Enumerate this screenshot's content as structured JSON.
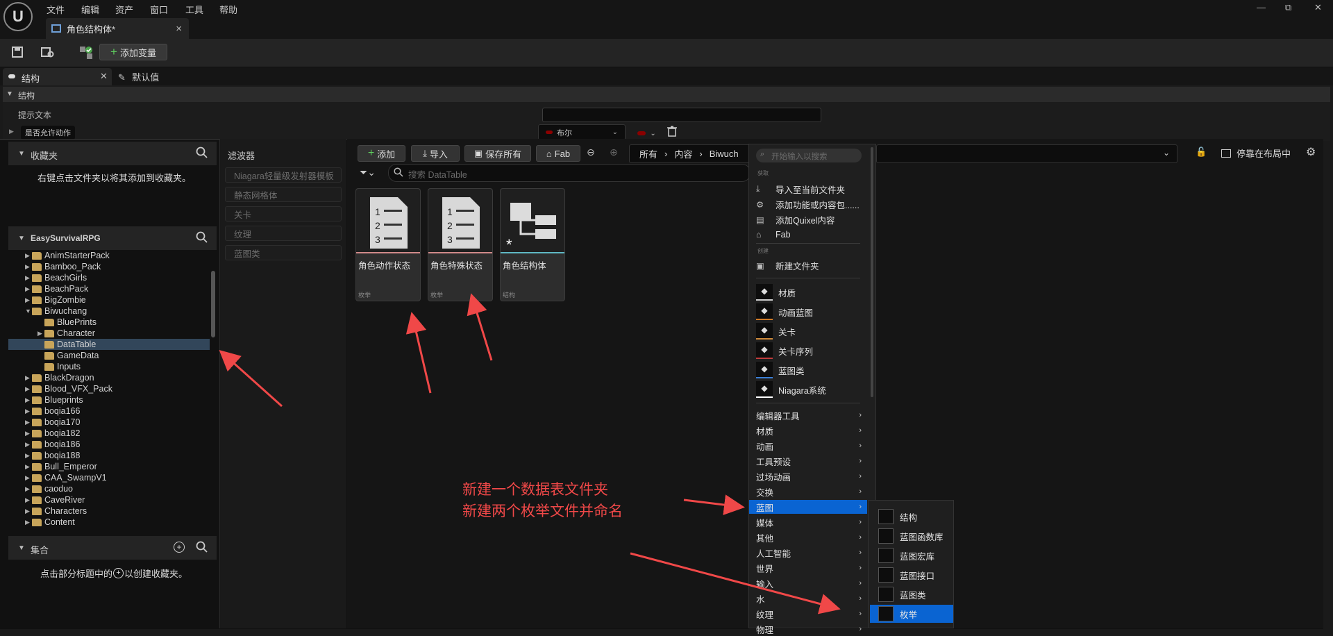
{
  "menubar": {
    "items": [
      "文件",
      "编辑",
      "资产",
      "窗口",
      "工具",
      "帮助"
    ],
    "window_controls": [
      "—",
      "⧉",
      "✕"
    ]
  },
  "tab": {
    "title": "角色结构体*",
    "close": "×"
  },
  "toolbar": {
    "add_variable": "添加变量",
    "add_icon": "+"
  },
  "structure_panel": {
    "tabs": [
      "结构",
      "默认值"
    ],
    "header": "结构",
    "rows": [
      {
        "label": "提示文本",
        "value": ""
      },
      {
        "label": "是否允许动作",
        "type": "布尔"
      }
    ]
  },
  "favorites": {
    "title": "收藏夹",
    "hint": "右键点击文件夹以将其添加到收藏夹。"
  },
  "project": {
    "title": "EasySurvivalRPG"
  },
  "tree": [
    {
      "label": "AnimStarterPack",
      "depth": 0,
      "expand": "▶"
    },
    {
      "label": "Bamboo_Pack",
      "depth": 0,
      "expand": "▶"
    },
    {
      "label": "BeachGirls",
      "depth": 0,
      "expand": "▶"
    },
    {
      "label": "BeachPack",
      "depth": 0,
      "expand": "▶"
    },
    {
      "label": "BigZombie",
      "depth": 0,
      "expand": "▶"
    },
    {
      "label": "Biwuchang",
      "depth": 0,
      "expand": "▼"
    },
    {
      "label": "BluePrints",
      "depth": 1,
      "expand": ""
    },
    {
      "label": "Character",
      "depth": 1,
      "expand": "▶"
    },
    {
      "label": "DataTable",
      "depth": 1,
      "expand": "",
      "selected": true
    },
    {
      "label": "GameData",
      "depth": 1,
      "expand": ""
    },
    {
      "label": "Inputs",
      "depth": 1,
      "expand": ""
    },
    {
      "label": "BlackDragon",
      "depth": 0,
      "expand": "▶"
    },
    {
      "label": "Blood_VFX_Pack",
      "depth": 0,
      "expand": "▶"
    },
    {
      "label": "Blueprints",
      "depth": 0,
      "expand": "▶"
    },
    {
      "label": "boqia166",
      "depth": 0,
      "expand": "▶"
    },
    {
      "label": "boqia170",
      "depth": 0,
      "expand": "▶"
    },
    {
      "label": "boqia182",
      "depth": 0,
      "expand": "▶"
    },
    {
      "label": "boqia186",
      "depth": 0,
      "expand": "▶"
    },
    {
      "label": "boqia188",
      "depth": 0,
      "expand": "▶"
    },
    {
      "label": "Bull_Emperor",
      "depth": 0,
      "expand": "▶"
    },
    {
      "label": "CAA_SwampV1",
      "depth": 0,
      "expand": "▶"
    },
    {
      "label": "caoduo",
      "depth": 0,
      "expand": "▶"
    },
    {
      "label": "CaveRiver",
      "depth": 0,
      "expand": "▶"
    },
    {
      "label": "Characters",
      "depth": 0,
      "expand": "▶"
    },
    {
      "label": "Content",
      "depth": 0,
      "expand": "▶"
    }
  ],
  "collections": {
    "title": "集合",
    "hint_before": "点击部分标题中的",
    "hint_after": "以创建收藏夹。"
  },
  "filters": {
    "title": "滤波器",
    "items": [
      "Niagara轻量级发射器模板",
      "静态网格体",
      "关卡",
      "纹理",
      "蓝图类"
    ]
  },
  "content": {
    "buttons": {
      "add": "添加",
      "import": "导入",
      "save_all": "保存所有",
      "fab": "Fab"
    },
    "breadcrumb": [
      "所有",
      "内容",
      "Biwuch"
    ],
    "search_placeholder": "搜索 DataTable",
    "dock_label": "停靠在布局中",
    "assets": [
      {
        "name": "角色动作状态",
        "type": "枚举",
        "bar_color": "#d08a8a"
      },
      {
        "name": "角色特殊状态",
        "type": "枚举",
        "bar_color": "#d08a8a"
      },
      {
        "name": "角色结构体",
        "type": "结构",
        "bar_color": "#5fb8c4"
      }
    ]
  },
  "context_menu": {
    "search_placeholder": "开始输入以搜索",
    "sections": {
      "get": "获取",
      "create": "创建"
    },
    "get_items": [
      "导入至当前文件夹",
      "添加功能或内容包......",
      "添加Quixel内容",
      "Fab"
    ],
    "new_folder": "新建文件夹",
    "create_items": [
      {
        "label": "材质",
        "icon": "material-icon",
        "color": "#cfcfcf"
      },
      {
        "label": "动画蓝图",
        "icon": "anim-blueprint-icon",
        "color": "#d07b28"
      },
      {
        "label": "关卡",
        "icon": "level-icon",
        "color": "#cf8a3a"
      },
      {
        "label": "关卡序列",
        "icon": "level-sequence-icon",
        "color": "#c03c3c"
      },
      {
        "label": "蓝图类",
        "icon": "blueprint-class-icon",
        "color": "#3b7fd6"
      },
      {
        "label": "Niagara系统",
        "icon": "niagara-icon",
        "color": "#ffffff"
      }
    ],
    "categories": [
      "编辑器工具",
      "材质",
      "动画",
      "工具预设",
      "过场动画",
      "交换",
      "蓝图",
      "媒体",
      "其他",
      "人工智能",
      "世界",
      "输入",
      "水",
      "纹理",
      "物理"
    ],
    "highlighted": "蓝图"
  },
  "submenu": {
    "items": [
      "结构",
      "蓝图函数库",
      "蓝图宏库",
      "蓝图接口",
      "蓝图类",
      "枚举"
    ],
    "highlighted": "枚举"
  },
  "annotation": {
    "line1": "新建一个数据表文件夹",
    "line2": "新建两个枚举文件并命名",
    "color": "#f04848"
  }
}
